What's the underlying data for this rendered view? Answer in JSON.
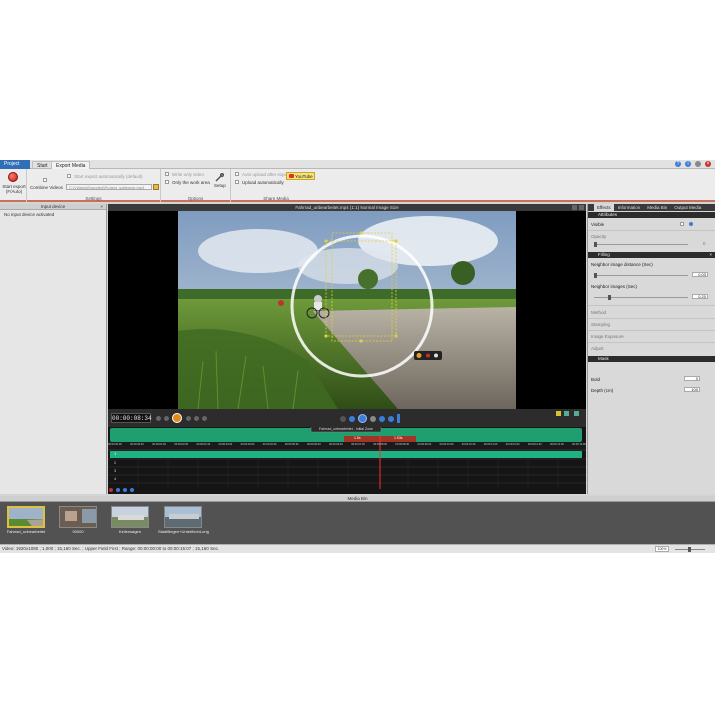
{
  "menu": {
    "tabs": [
      {
        "label": "Project"
      },
      {
        "label": "Start"
      },
      {
        "label": "Export Media"
      }
    ]
  },
  "ribbon": {
    "start_export_label": "Start export\n(F/Auto)",
    "combine_videos_label": "Combine Videos",
    "settings": {
      "option1": "Start export automatically (default)",
      "path": "C:\\Videos\\Exported\\Project_softencer.mp4",
      "group_label": "Settings"
    },
    "options": {
      "option1": "Write only video",
      "option2": "Only the work area",
      "setup_label": "Setup",
      "group_label": "Options"
    },
    "share": {
      "option1": "Auto upload after export",
      "option2": "Upload automatically",
      "youtube_label": "YouTube",
      "group_label": "Share Media"
    }
  },
  "input_device": {
    "title": "Input device",
    "message": "No input device activated"
  },
  "video": {
    "title": "Fahrrad_unbearbeitet.mp4 (1:1) Normal Image Size",
    "timecode": "00:00:08:34"
  },
  "timeline": {
    "clip_label": "Fahrrad_unbearbeitet - Initial Zone",
    "marker1": "1.5s",
    "marker2": "1.53s",
    "ruler": [
      "00:00:00:00",
      "00:00:00:40",
      "00:00:01:20",
      "00:00:02:00",
      "00:00:02:40",
      "00:00:03:20",
      "00:00:04:00",
      "00:00:04:40",
      "00:00:05:20",
      "00:00:06:00",
      "00:00:06:40",
      "00:00:07:20",
      "00:00:08:00",
      "00:00:08:40",
      "00:00:09:20",
      "00:00:10:00",
      "00:00:10:40",
      "00:00:11:20",
      "00:00:12:00",
      "00:00:12:40",
      "00:00:13:20",
      "00:00:14:00"
    ],
    "tracks": [
      "1",
      "2",
      "3",
      "4"
    ]
  },
  "right_panel": {
    "tabs": [
      {
        "label": "Effects"
      },
      {
        "label": "Information"
      },
      {
        "label": "Media Bin"
      },
      {
        "label": "Output Media"
      }
    ],
    "attributes": {
      "title": "Attributes",
      "visible_label": "Visible",
      "opacity_label": "Opacity",
      "opacity_value": "0"
    },
    "filling": {
      "title": "Filling",
      "neighbor_distance_label": "Neighbor image distance (Sec)",
      "neighbor_distance_value": "0.03",
      "neighbor_images_label": "Neighbor images (Sec)",
      "neighbor_images_value": "0.20",
      "method_label": "Method",
      "stamping_label": "Stamping",
      "image_exposure_label": "Image Exposure",
      "adjust_label": "Adjust"
    },
    "mask": {
      "title": "Mask",
      "bold_label": "Bold",
      "bold_value": "0",
      "depth_label": "Depth (cm)",
      "depth_value": "100"
    }
  },
  "media_bin": {
    "title": "Media Bin",
    "items": [
      {
        "label": "Fahrrad_unbearbeitet"
      },
      {
        "label": "00000"
      },
      {
        "label": "Kellerwagen"
      },
      {
        "label": "Stadtfliegen+Unterflecht-orig"
      }
    ]
  },
  "status": {
    "text": "Video: 1920x1080 ; 1,000 ; 15,160 Sec. ; Upper Field First ; Range: 00:00:00:00 to 00:00:15:07 ; 15,160 Sec.",
    "zoom": "100%"
  },
  "colors": {
    "accent": "#2f6fb5",
    "timeline_track": "#1fa37a",
    "marker": "#c0392b",
    "youtube": "#f5e27a"
  }
}
